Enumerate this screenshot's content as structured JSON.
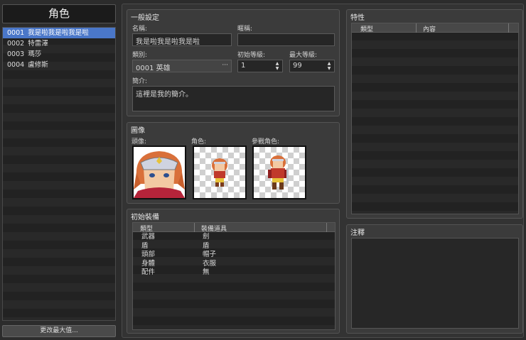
{
  "left": {
    "title": "角色",
    "actors": [
      {
        "id": "0001",
        "name": "我是啦我是啦我是啦",
        "selected": true
      },
      {
        "id": "0002",
        "name": "特雷澤",
        "selected": false
      },
      {
        "id": "0003",
        "name": "瑪莎",
        "selected": false
      },
      {
        "id": "0004",
        "name": "盧修斯",
        "selected": false
      }
    ],
    "change_max_button": "更改最大值..."
  },
  "general": {
    "title": "一般設定",
    "name_label": "名稱:",
    "name_value": "我是啦我是啦我是啦",
    "nickname_label": "暱稱:",
    "nickname_value": "",
    "class_label": "類別:",
    "class_value": "0001 英雄",
    "class_button": "···",
    "initial_level_label": "初始等級:",
    "initial_level_value": "1",
    "max_level_label": "最大等級:",
    "max_level_value": "99",
    "profile_label": "簡介:",
    "profile_value": "這裡是我的簡介。"
  },
  "images": {
    "title": "圖像",
    "face_label": "頭像:",
    "character_label": "角色:",
    "battler_label": "參戰角色:"
  },
  "equipment": {
    "title": "初始裝備",
    "col_type": "類型",
    "col_item": "裝備道具",
    "rows": [
      {
        "type": "武器",
        "item": "劍"
      },
      {
        "type": "盾",
        "item": "盾"
      },
      {
        "type": "頭部",
        "item": "帽子"
      },
      {
        "type": "身體",
        "item": "衣服"
      },
      {
        "type": "配件",
        "item": "無"
      }
    ]
  },
  "traits": {
    "title": "特性",
    "col_type": "類型",
    "col_content": "內容"
  },
  "note": {
    "title": "注釋",
    "value": ""
  },
  "colors": {
    "selection": "#4a77c9",
    "background": "#2c2c2c",
    "panel": "#3b3b3b"
  }
}
